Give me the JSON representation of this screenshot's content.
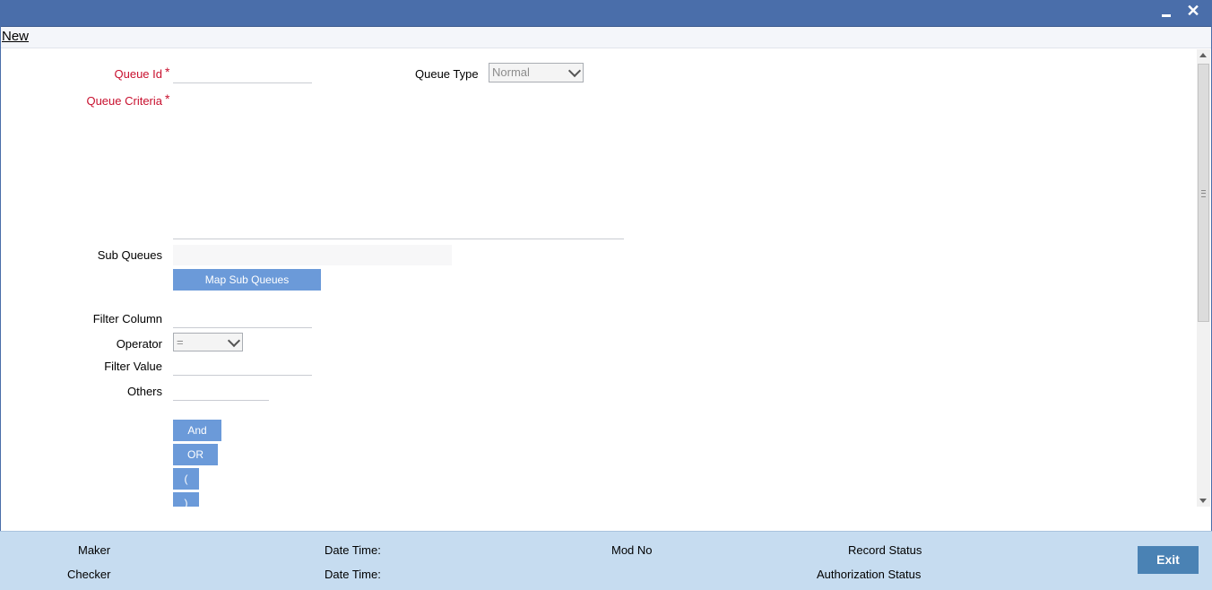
{
  "menu": {
    "new_label": "New"
  },
  "form": {
    "queue_id": {
      "label": "Queue Id",
      "required": "*",
      "value": ""
    },
    "queue_type": {
      "label": "Queue Type",
      "selected": "Normal"
    },
    "queue_criteria": {
      "label": "Queue Criteria",
      "required": "*",
      "value": ""
    },
    "sub_queues": {
      "label": "Sub Queues",
      "value": ""
    },
    "map_sub_queues_button": "Map Sub Queues",
    "filter_column": {
      "label": "Filter Column",
      "value": ""
    },
    "operator": {
      "label": "Operator",
      "selected": "="
    },
    "filter_value": {
      "label": "Filter Value",
      "value": ""
    },
    "others": {
      "label": "Others",
      "value": ""
    },
    "logic_buttons": {
      "and": "And",
      "or": "OR",
      "open_paren": "(",
      "close_paren": ")"
    }
  },
  "footer": {
    "maker": "Maker",
    "checker": "Checker",
    "date_time_1": "Date Time:",
    "date_time_2": "Date Time:",
    "mod_no": "Mod No",
    "record_status": "Record Status",
    "authorization_status": "Authorization Status",
    "exit_button": "Exit"
  },
  "colors": {
    "title_bar": "#4a6eaa",
    "required_label": "#c8102e",
    "button_blue": "#6b9ad9",
    "footer_bg": "#c6dcf0",
    "exit_button": "#4a82b4"
  },
  "icons": [
    "minimize-icon",
    "close-icon",
    "chevron-down-icon",
    "scroll-up-arrow-icon",
    "scroll-down-arrow-icon"
  ]
}
